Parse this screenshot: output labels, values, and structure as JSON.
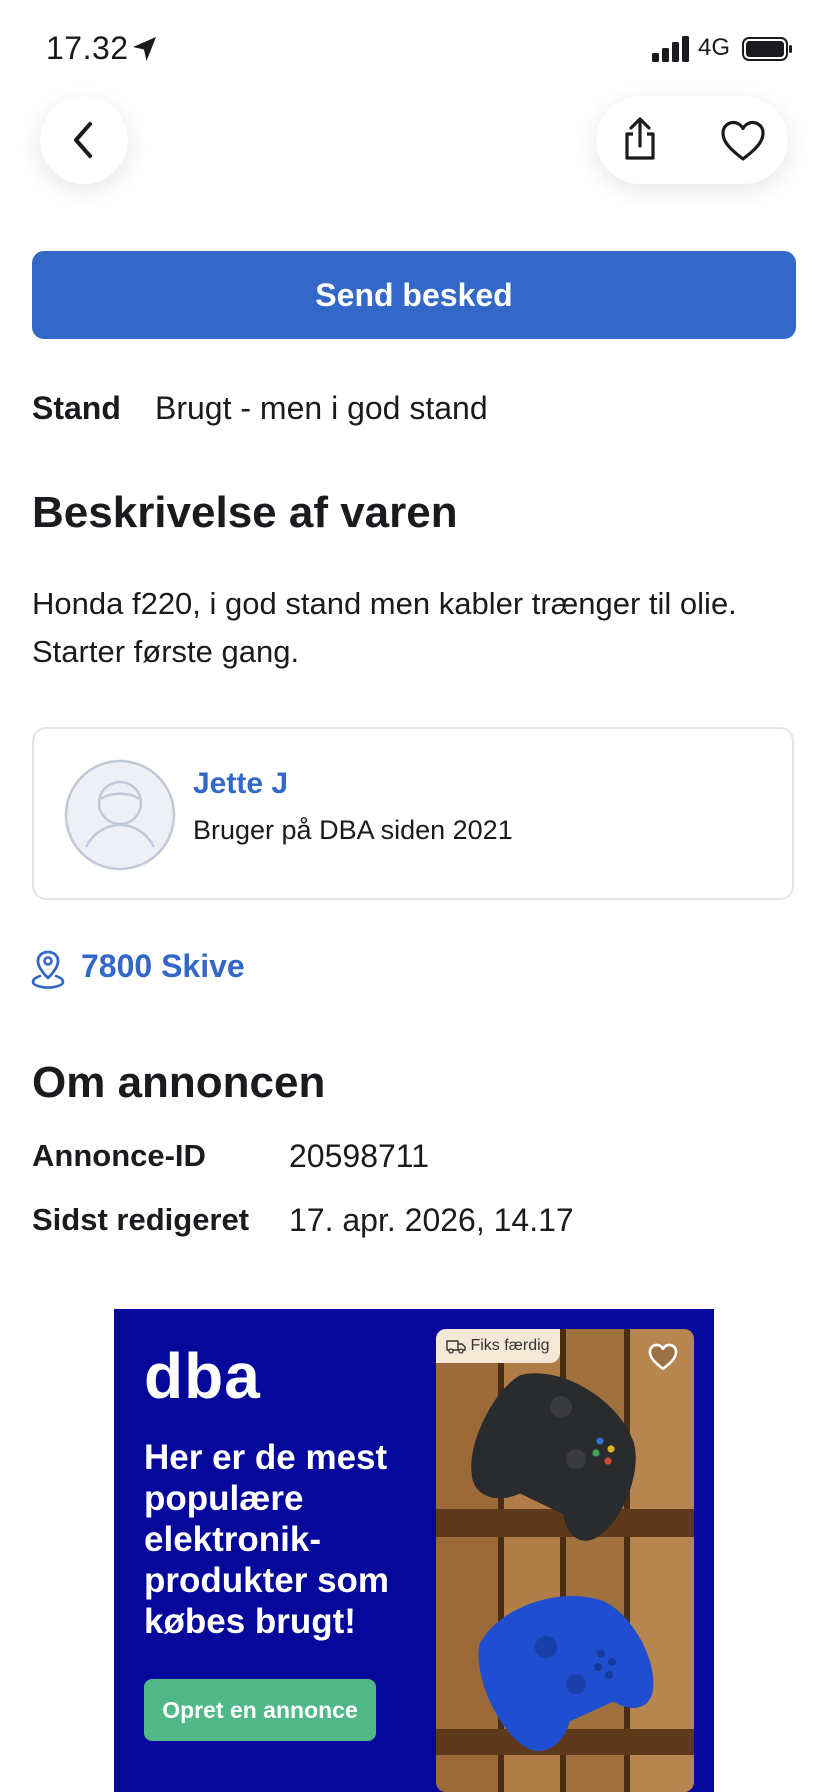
{
  "status_bar": {
    "time": "17.32",
    "network": "4G"
  },
  "header": {
    "back_icon": "chevron-left-icon",
    "share_icon": "share-icon",
    "favorite_icon": "heart-outline-icon"
  },
  "primary_action": {
    "label": "Send besked",
    "color": "#3368c9"
  },
  "condition": {
    "label": "Stand",
    "value": "Brugt - men i god stand"
  },
  "description": {
    "heading": "Beskrivelse af varen",
    "text": "Honda f220, i god stand men kabler trænger til olie. Starter første gang."
  },
  "seller": {
    "name": "Jette J",
    "since": "Bruger på DBA siden 2021",
    "avatar_icon": "user-avatar-icon"
  },
  "location": {
    "text": "7800 Skive",
    "icon": "location-pin-icon"
  },
  "about": {
    "heading": "Om annoncen",
    "rows": [
      {
        "label": "Annonce-ID",
        "value": "20598711"
      },
      {
        "label": "Sidst redigeret",
        "value": "17. apr. 2026, 14.17"
      }
    ]
  },
  "ad_banner": {
    "logo": "dba",
    "headline": "Her er de mest populære elektronik-produkter som købes brugt!",
    "cta": "Opret en annonce",
    "tag": "Fiks færdig",
    "tag_icon": "delivery-truck-icon",
    "favorite_icon": "heart-outline-icon",
    "background_color": "#05089a",
    "cta_color": "#4fb886"
  }
}
